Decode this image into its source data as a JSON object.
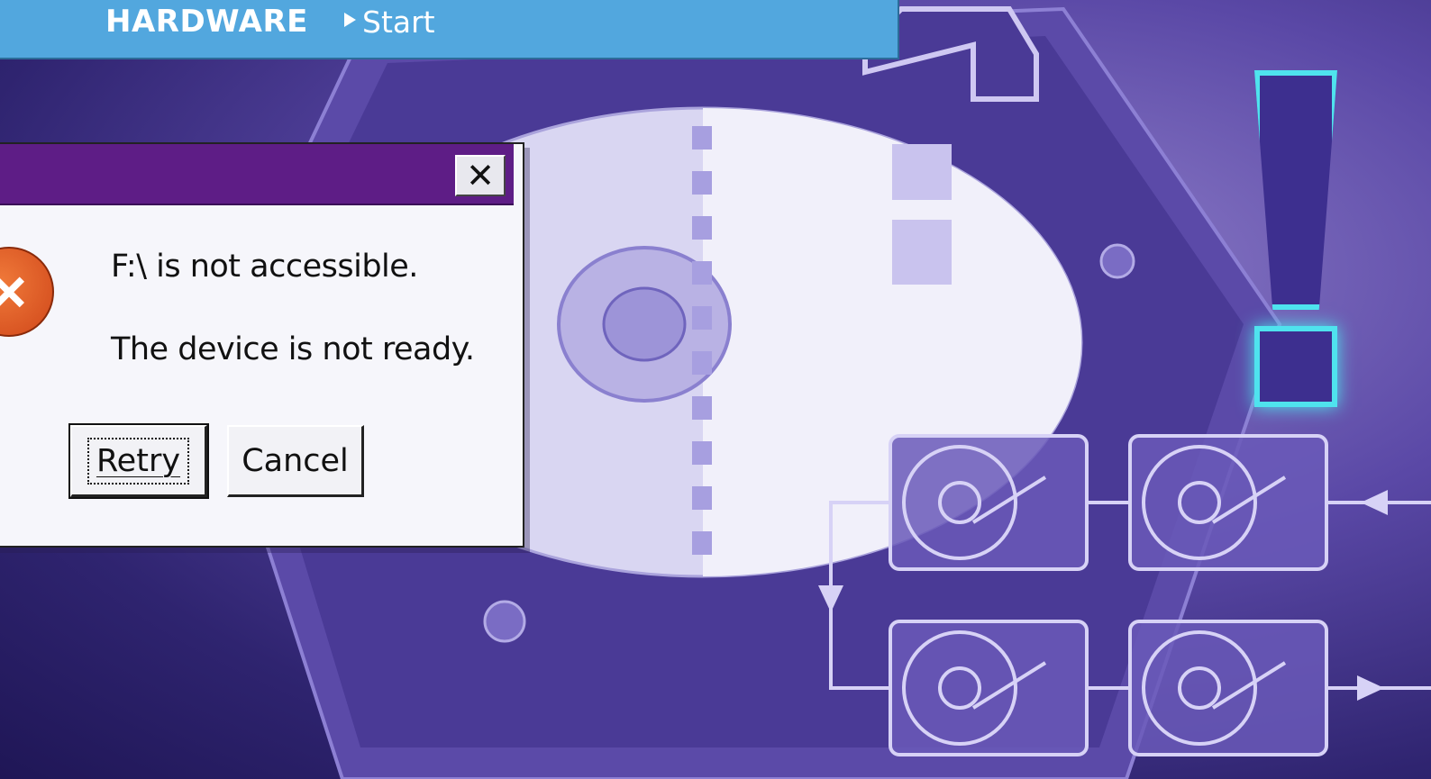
{
  "header": {
    "section": "HARDWARE",
    "breadcrumb": "Start"
  },
  "dialog": {
    "close_glyph": "✕",
    "error_icon": "error-icon",
    "message_line1": "F:\\ is not accessible.",
    "message_line2": "The device is not ready.",
    "retry_label": "Retry",
    "cancel_label": "Cancel"
  },
  "colors": {
    "banner": "#52a7de",
    "titlebar": "#5e1d86",
    "glow": "#4fe3ee",
    "background": "#5a48a6"
  }
}
